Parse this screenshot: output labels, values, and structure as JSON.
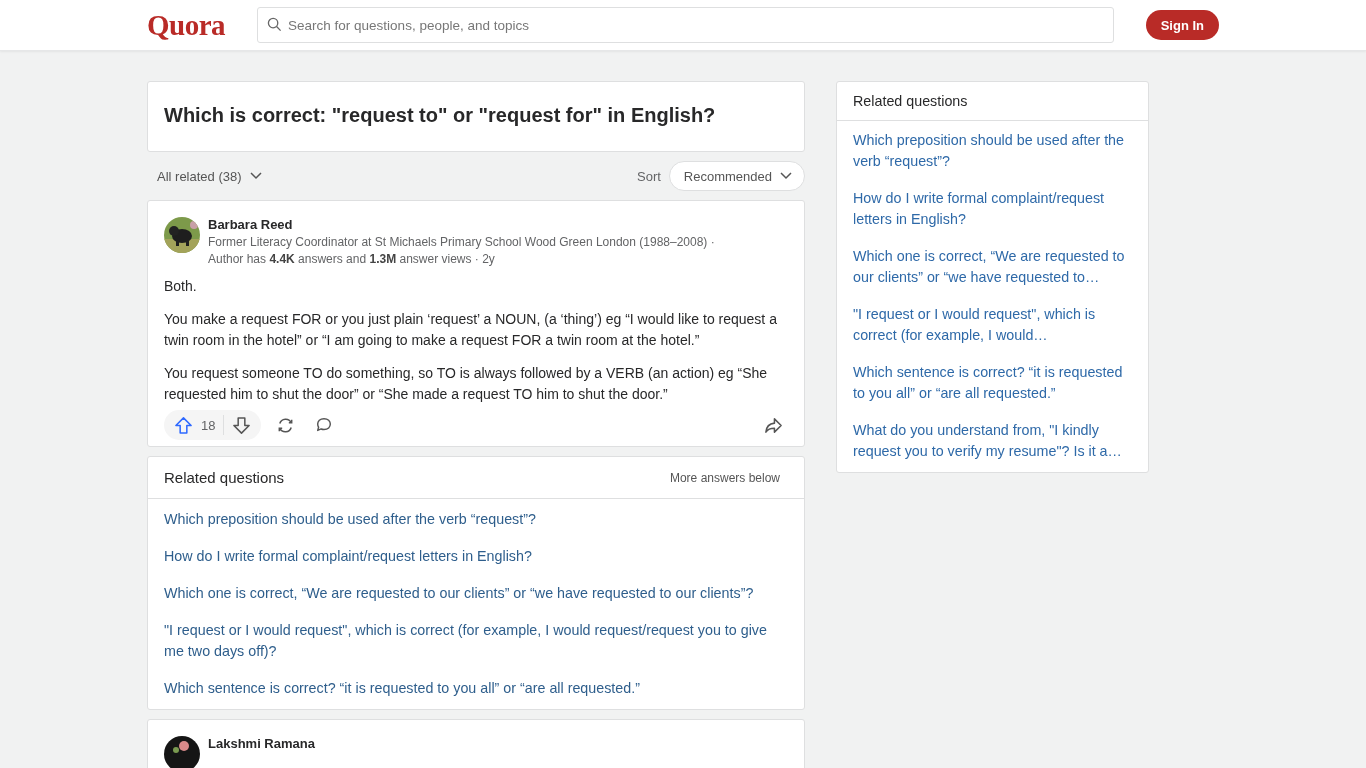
{
  "header": {
    "logo": "Quora",
    "search": {
      "placeholder": "Search for questions, people, and topics"
    },
    "sign_in": "Sign In"
  },
  "question": {
    "title": "Which is correct: \"request to\" or \"request for\" in English?"
  },
  "filter": {
    "label": "All related (38)",
    "sort_label": "Sort",
    "sort_value": "Recommended"
  },
  "answer": {
    "author": "Barbara Reed",
    "credential": "Former Literacy Coordinator at St Michaels Primary School Wood Green London (1988–2008) ·",
    "meta": "Author has **4.4K** answers and **1.3M** answer views · 2y",
    "paragraphs": [
      "Both.",
      "You make a request FOR or you just plain ‘request’ a NOUN, (a ‘thing’) eg “I would like to request a twin room in the hotel” or “I am going to make a request FOR a twin room at the hotel.”",
      "You request someone TO do something, so TO is always followed by a VERB (an action) eg “She requested him to shut the door” or “She made a request TO him to shut the door.”"
    ],
    "upvotes": "18"
  },
  "related_inline": {
    "title": "Related questions",
    "note": "More answers below",
    "items": [
      "Which preposition should be used after the verb “request”?",
      "How do I write formal complaint/request letters in English?",
      "Which one is correct, “We are requested to our clients” or “we have requested to our clients”?",
      "\"I request or I would request\", which is correct (for example, I would request/request you to give me two days off)?",
      "Which sentence is correct? “it is requested to you all” or “are all requested.”"
    ]
  },
  "next_answer": {
    "author": "Lakshmi Ramana"
  },
  "sidebar": {
    "title": "Related questions",
    "items": [
      "Which preposition should be used after the verb “request”?",
      "How do I write formal complaint/request letters in English?",
      "Which one is correct, “We are requested to our clients” or “we have requested to…",
      "\"I request or I would request\", which is correct (for example, I would…",
      "Which sentence is correct? “it is requested to you all” or “are all requested.”",
      "What do you understand from, \"I kindly request you to verify my resume\"? Is it a…"
    ]
  }
}
